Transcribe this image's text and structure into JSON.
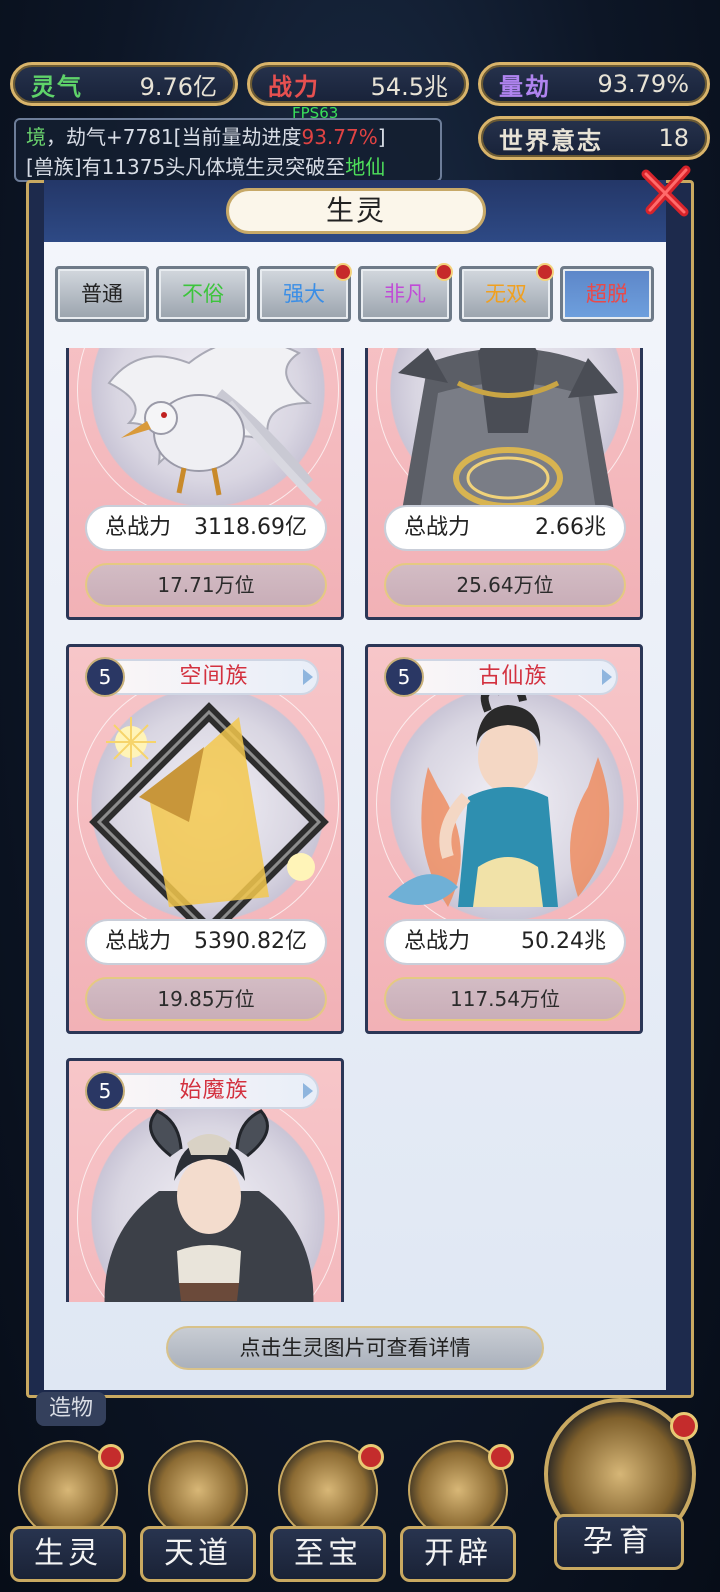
{
  "hud": {
    "lingqi": {
      "label": "灵气",
      "value": "9.76亿",
      "color": "#5fd36a"
    },
    "zhanli": {
      "label": "战力",
      "value": "54.5兆",
      "color": "#e65050"
    },
    "liangjie": {
      "label": "量劫",
      "value": "93.79%",
      "color": "#b084f0"
    },
    "shijie": {
      "label": "世界意志",
      "value": "18",
      "color": "#e8e3d6"
    },
    "fps": "FPS63"
  },
  "ticker": {
    "line1_a": "境",
    "line1_b": "，劫气+7781[当前量劫进度",
    "line1_c": "93.77%",
    "line1_d": "]",
    "line2_a": "[兽族]有11375头凡体境生灵突破至",
    "line2_b": "地仙"
  },
  "panel": {
    "title": "生灵",
    "tabs": [
      {
        "label": "普通",
        "color": "#222222",
        "dot": false
      },
      {
        "label": "不俗",
        "color": "#3cc43c",
        "dot": false
      },
      {
        "label": "强大",
        "color": "#3a8ee6",
        "dot": true
      },
      {
        "label": "非凡",
        "color": "#c04cd6",
        "dot": true
      },
      {
        "label": "无双",
        "color": "#f0a020",
        "dot": true
      },
      {
        "label": "超脱",
        "color": "#e84a4a",
        "dot": false,
        "active": true
      }
    ],
    "cards": [
      {
        "race": "",
        "level": "",
        "power_label": "总战力",
        "power": "3118.69亿",
        "rank": "17.71万位",
        "art": "phoenix-bird"
      },
      {
        "race": "",
        "level": "",
        "power_label": "总战力",
        "power": "2.66兆",
        "rank": "25.64万位",
        "art": "three-headed-dragon"
      },
      {
        "race": "空间族",
        "level": "5",
        "power_label": "总战力",
        "power": "5390.82亿",
        "rank": "19.85万位",
        "art": "golden-crystal"
      },
      {
        "race": "古仙族",
        "level": "5",
        "power_label": "总战力",
        "power": "50.24兆",
        "rank": "117.54万位",
        "art": "celestial-maiden"
      },
      {
        "race": "始魔族",
        "level": "5",
        "power_label": "",
        "power": "",
        "rank": "",
        "art": "horned-demon-girl"
      }
    ],
    "hint": "点击生灵图片可查看详情"
  },
  "bottom": {
    "zaowu": "造物",
    "nav": [
      {
        "label": "生灵",
        "dot": true
      },
      {
        "label": "天道",
        "dot": false
      },
      {
        "label": "至宝",
        "dot": true
      },
      {
        "label": "开辟",
        "dot": true
      }
    ],
    "yunyu": "孕育"
  }
}
